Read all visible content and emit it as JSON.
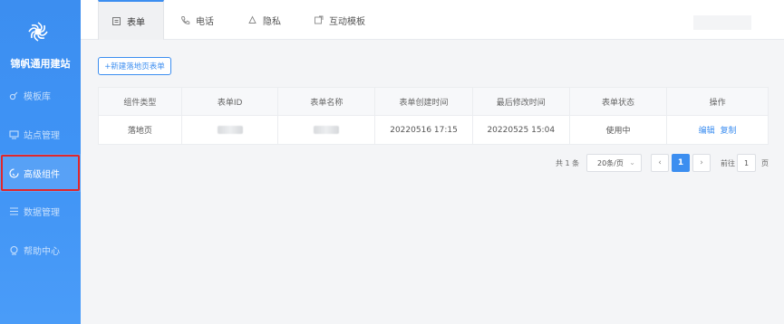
{
  "sidebar": {
    "brand": "锦帆通用建站",
    "items": [
      {
        "label": "模板库",
        "icon": "template-icon"
      },
      {
        "label": "站点管理",
        "icon": "monitor-icon"
      },
      {
        "label": "高级组件",
        "icon": "component-icon",
        "active": true
      },
      {
        "label": "数据管理",
        "icon": "list-icon"
      },
      {
        "label": "帮助中心",
        "icon": "help-icon"
      }
    ]
  },
  "tabs": [
    {
      "label": "表单",
      "icon": "form-icon",
      "active": true
    },
    {
      "label": "电话",
      "icon": "phone-icon"
    },
    {
      "label": "隐私",
      "icon": "bell-icon"
    },
    {
      "label": "互动模板",
      "icon": "interactive-icon"
    }
  ],
  "toolbar": {
    "new_button": "+新建落地页表单"
  },
  "table": {
    "columns": [
      "组件类型",
      "表单ID",
      "表单名称",
      "表单创建时间",
      "最后修改时间",
      "表单状态",
      "操作"
    ],
    "rows": [
      {
        "type": "落地页",
        "id": "",
        "name": "",
        "created": "20220516 17:15",
        "modified": "20220525 15:04",
        "status": "使用中",
        "actions": [
          "编辑",
          "复制"
        ]
      }
    ]
  },
  "pagination": {
    "total": "共 1 条",
    "page_size": "20条/页",
    "prev": "‹",
    "current": "1",
    "next": "›",
    "goto_label": "前往",
    "goto_value": "1",
    "page_suffix": "页"
  },
  "colors": {
    "accent": "#3c8ef0",
    "highlight_border": "#e0262b"
  }
}
